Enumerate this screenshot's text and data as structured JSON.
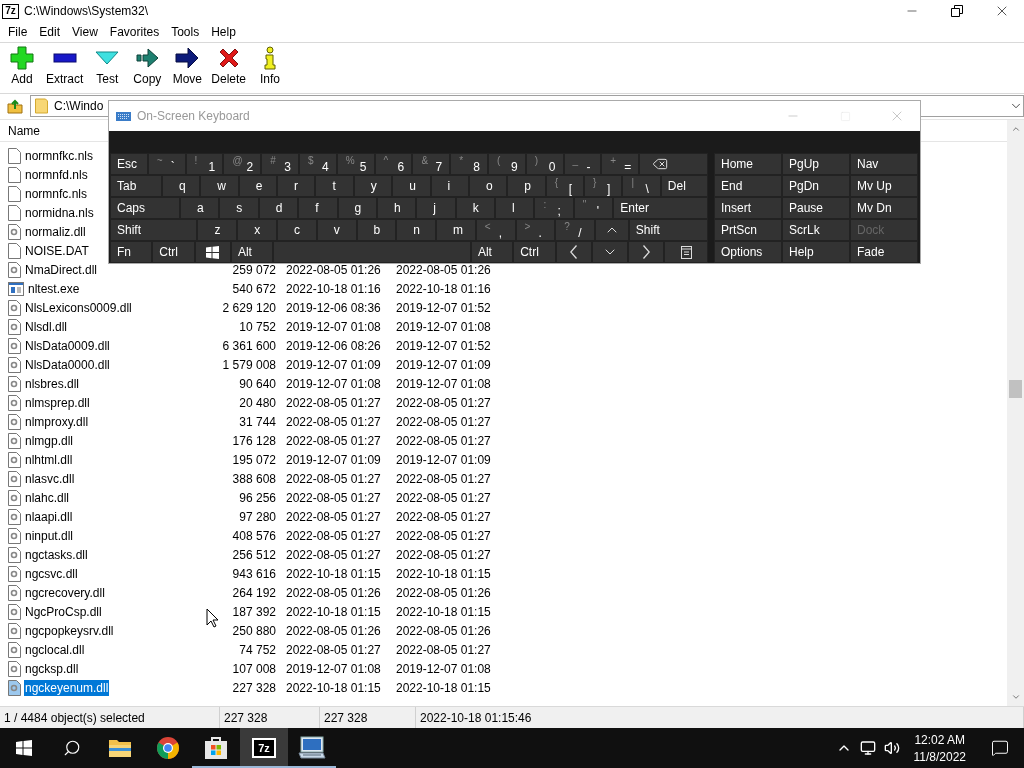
{
  "window": {
    "icon_label": "7z",
    "title": "C:\\Windows\\System32\\"
  },
  "menu": [
    "File",
    "Edit",
    "View",
    "Favorites",
    "Tools",
    "Help"
  ],
  "toolbar": [
    {
      "kind": "add",
      "label": "Add"
    },
    {
      "kind": "extract",
      "label": "Extract"
    },
    {
      "kind": "test",
      "label": "Test"
    },
    {
      "kind": "copy",
      "label": "Copy"
    },
    {
      "kind": "move",
      "label": "Move"
    },
    {
      "kind": "delete",
      "label": "Delete"
    },
    {
      "kind": "info",
      "label": "Info"
    }
  ],
  "address": {
    "value": "C:\\Windo"
  },
  "list": {
    "columns": [
      "Name"
    ],
    "rows": [
      {
        "kind": "file",
        "name": "normnfkc.nls",
        "selected": false
      },
      {
        "kind": "file",
        "name": "normnfd.nls",
        "selected": false
      },
      {
        "kind": "file",
        "name": "normnfc.nls",
        "selected": false
      },
      {
        "kind": "file",
        "name": "normidna.nls",
        "selected": false
      },
      {
        "kind": "dll",
        "name": "normaliz.dll",
        "selected": false
      },
      {
        "kind": "file",
        "name": "NOISE.DAT",
        "selected": false
      },
      {
        "kind": "dll",
        "name": "NmaDirect.dll",
        "size": "259 072",
        "modified": "2022-08-05 01:26",
        "created": "2022-08-05 01:26",
        "selected": false
      },
      {
        "kind": "exe",
        "name": "nltest.exe",
        "size": "540 672",
        "modified": "2022-10-18 01:16",
        "created": "2022-10-18 01:16",
        "selected": false
      },
      {
        "kind": "dll",
        "name": "NlsLexicons0009.dll",
        "size": "2 629 120",
        "modified": "2019-12-06 08:36",
        "created": "2019-12-07 01:52",
        "selected": false
      },
      {
        "kind": "dll",
        "name": "Nlsdl.dll",
        "size": "10 752",
        "modified": "2019-12-07 01:08",
        "created": "2019-12-07 01:08",
        "selected": false
      },
      {
        "kind": "dll",
        "name": "NlsData0009.dll",
        "size": "6 361 600",
        "modified": "2019-12-06 08:26",
        "created": "2019-12-07 01:52",
        "selected": false
      },
      {
        "kind": "dll",
        "name": "NlsData0000.dll",
        "size": "1 579 008",
        "modified": "2019-12-07 01:09",
        "created": "2019-12-07 01:09",
        "selected": false
      },
      {
        "kind": "dll",
        "name": "nlsbres.dll",
        "size": "90 640",
        "modified": "2019-12-07 01:08",
        "created": "2019-12-07 01:08",
        "selected": false
      },
      {
        "kind": "dll",
        "name": "nlmsprep.dll",
        "size": "20 480",
        "modified": "2022-08-05 01:27",
        "created": "2022-08-05 01:27",
        "selected": false
      },
      {
        "kind": "dll",
        "name": "nlmproxy.dll",
        "size": "31 744",
        "modified": "2022-08-05 01:27",
        "created": "2022-08-05 01:27",
        "selected": false
      },
      {
        "kind": "dll",
        "name": "nlmgp.dll",
        "size": "176 128",
        "modified": "2022-08-05 01:27",
        "created": "2022-08-05 01:27",
        "selected": false
      },
      {
        "kind": "dll",
        "name": "nlhtml.dll",
        "size": "195 072",
        "modified": "2019-12-07 01:09",
        "created": "2019-12-07 01:09",
        "selected": false
      },
      {
        "kind": "dll",
        "name": "nlasvc.dll",
        "size": "388 608",
        "modified": "2022-08-05 01:27",
        "created": "2022-08-05 01:27",
        "selected": false
      },
      {
        "kind": "dll",
        "name": "nlahc.dll",
        "size": "96 256",
        "modified": "2022-08-05 01:27",
        "created": "2022-08-05 01:27",
        "selected": false
      },
      {
        "kind": "dll",
        "name": "nlaapi.dll",
        "size": "97 280",
        "modified": "2022-08-05 01:27",
        "created": "2022-08-05 01:27",
        "selected": false
      },
      {
        "kind": "dll",
        "name": "ninput.dll",
        "size": "408 576",
        "modified": "2022-08-05 01:27",
        "created": "2022-08-05 01:27",
        "selected": false
      },
      {
        "kind": "dll",
        "name": "ngctasks.dll",
        "size": "256 512",
        "modified": "2022-08-05 01:27",
        "created": "2022-08-05 01:27",
        "selected": false
      },
      {
        "kind": "dll",
        "name": "ngcsvc.dll",
        "size": "943 616",
        "modified": "2022-10-18 01:15",
        "created": "2022-10-18 01:15",
        "selected": false
      },
      {
        "kind": "dll",
        "name": "ngcrecovery.dll",
        "size": "264 192",
        "modified": "2022-08-05 01:26",
        "created": "2022-08-05 01:26",
        "selected": false
      },
      {
        "kind": "dll",
        "name": "NgcProCsp.dll",
        "size": "187 392",
        "modified": "2022-10-18 01:15",
        "created": "2022-10-18 01:15",
        "selected": false
      },
      {
        "kind": "dll",
        "name": "ngcpopkeysrv.dll",
        "size": "250 880",
        "modified": "2022-08-05 01:26",
        "created": "2022-08-05 01:26",
        "selected": false
      },
      {
        "kind": "dll",
        "name": "ngclocal.dll",
        "size": "74 752",
        "modified": "2022-08-05 01:27",
        "created": "2022-08-05 01:27",
        "selected": false
      },
      {
        "kind": "dll",
        "name": "ngcksp.dll",
        "size": "107 008",
        "modified": "2019-12-07 01:08",
        "created": "2019-12-07 01:08",
        "selected": false
      },
      {
        "kind": "dll",
        "name": "ngckeyenum.dll",
        "size": "227 328",
        "modified": "2022-10-18 01:15",
        "created": "2022-10-18 01:15",
        "selected": true
      }
    ]
  },
  "status_bar": [
    "1 / 4484 object(s) selected",
    "227 328",
    "227 328",
    "2022-10-18 01:15:46"
  ],
  "keyboard": {
    "title": "On-Screen Keyboard",
    "rows": [
      {
        "keys": [
          {
            "kind": "text",
            "label": "Esc"
          },
          {
            "kind": "char",
            "shift": "~",
            "label": "`"
          },
          {
            "kind": "char",
            "shift": "!",
            "label": "1"
          },
          {
            "kind": "char",
            "shift": "@",
            "label": "2"
          },
          {
            "kind": "char",
            "shift": "#",
            "label": "3"
          },
          {
            "kind": "char",
            "shift": "$",
            "label": "4"
          },
          {
            "kind": "char",
            "shift": "%",
            "label": "5"
          },
          {
            "kind": "char",
            "shift": "^",
            "label": "6"
          },
          {
            "kind": "char",
            "shift": "&",
            "label": "7"
          },
          {
            "kind": "char",
            "shift": "*",
            "label": "8"
          },
          {
            "kind": "char",
            "shift": "(",
            "label": "9"
          },
          {
            "kind": "char",
            "shift": ")",
            "label": "0"
          },
          {
            "kind": "char",
            "shift": "_",
            "label": "-"
          },
          {
            "kind": "char",
            "shift": "+",
            "label": "="
          },
          {
            "kind": "back"
          }
        ]
      },
      {
        "keys": [
          {
            "kind": "tab",
            "label": "Tab"
          },
          {
            "kind": "char",
            "label": "q"
          },
          {
            "kind": "char",
            "label": "w"
          },
          {
            "kind": "char",
            "label": "e"
          },
          {
            "kind": "char",
            "label": "r"
          },
          {
            "kind": "char",
            "label": "t"
          },
          {
            "kind": "char",
            "label": "y"
          },
          {
            "kind": "char",
            "label": "u"
          },
          {
            "kind": "char",
            "label": "i"
          },
          {
            "kind": "char",
            "label": "o"
          },
          {
            "kind": "char",
            "label": "p"
          },
          {
            "kind": "char",
            "shift": "{",
            "label": "["
          },
          {
            "kind": "char",
            "shift": "}",
            "label": "]"
          },
          {
            "kind": "char",
            "shift": "|",
            "label": "\\"
          },
          {
            "kind": "del",
            "label": "Del"
          }
        ]
      },
      {
        "keys": [
          {
            "kind": "caps",
            "label": "Caps"
          },
          {
            "kind": "char",
            "label": "a"
          },
          {
            "kind": "char",
            "label": "s"
          },
          {
            "kind": "char",
            "label": "d"
          },
          {
            "kind": "char",
            "label": "f"
          },
          {
            "kind": "char",
            "label": "g"
          },
          {
            "kind": "char",
            "label": "h"
          },
          {
            "kind": "char",
            "label": "j"
          },
          {
            "kind": "char",
            "label": "k"
          },
          {
            "kind": "char",
            "label": "l"
          },
          {
            "kind": "char",
            "shift": ":",
            "label": ";"
          },
          {
            "kind": "char",
            "shift": "\"",
            "label": "'"
          },
          {
            "kind": "enter",
            "label": "Enter"
          }
        ]
      },
      {
        "keys": [
          {
            "kind": "lshift",
            "label": "Shift"
          },
          {
            "kind": "char",
            "label": "z"
          },
          {
            "kind": "char",
            "label": "x"
          },
          {
            "kind": "char",
            "label": "c"
          },
          {
            "kind": "char",
            "label": "v"
          },
          {
            "kind": "char",
            "label": "b"
          },
          {
            "kind": "char",
            "label": "n"
          },
          {
            "kind": "char",
            "label": "m"
          },
          {
            "kind": "char",
            "shift": "<",
            "label": ","
          },
          {
            "kind": "char",
            "shift": ">",
            "label": "."
          },
          {
            "kind": "char",
            "shift": "?",
            "label": "/"
          },
          {
            "kind": "up"
          },
          {
            "kind": "rshift",
            "label": "Shift"
          }
        ]
      },
      {
        "keys": [
          {
            "kind": "text",
            "label": "Fn"
          },
          {
            "kind": "text",
            "label": "Ctrl"
          },
          {
            "kind": "win"
          },
          {
            "kind": "text",
            "label": "Alt"
          },
          {
            "kind": "space"
          },
          {
            "kind": "text",
            "label": "Alt"
          },
          {
            "kind": "text",
            "label": "Ctrl"
          },
          {
            "kind": "left"
          },
          {
            "kind": "down"
          },
          {
            "kind": "right"
          },
          {
            "kind": "menu"
          }
        ]
      }
    ],
    "nav": [
      {
        "label": "Home",
        "disabled": false
      },
      {
        "label": "PgUp",
        "disabled": false
      },
      {
        "label": "Nav",
        "disabled": false
      },
      {
        "label": "End",
        "disabled": false
      },
      {
        "label": "PgDn",
        "disabled": false
      },
      {
        "label": "Mv Up",
        "disabled": false
      },
      {
        "label": "Insert",
        "disabled": false
      },
      {
        "label": "Pause",
        "disabled": false
      },
      {
        "label": "Mv Dn",
        "disabled": false
      },
      {
        "label": "PrtScn",
        "disabled": false
      },
      {
        "label": "ScrLk",
        "disabled": false
      },
      {
        "label": "Dock",
        "disabled": true
      },
      {
        "label": "Options",
        "disabled": false
      },
      {
        "label": "Help",
        "disabled": false
      },
      {
        "label": "Fade",
        "disabled": false
      }
    ]
  },
  "taskbar": {
    "items": [
      {
        "kind": "explorer",
        "running": false,
        "active": false
      },
      {
        "kind": "chrome",
        "running": false,
        "active": false
      },
      {
        "kind": "store",
        "running": true,
        "active": false
      },
      {
        "kind": "archiver",
        "label": "7z",
        "running": true,
        "active": true
      },
      {
        "kind": "keyboard",
        "running": true,
        "active": false
      }
    ],
    "time": "12:02 AM",
    "date": "11/8/2022"
  }
}
